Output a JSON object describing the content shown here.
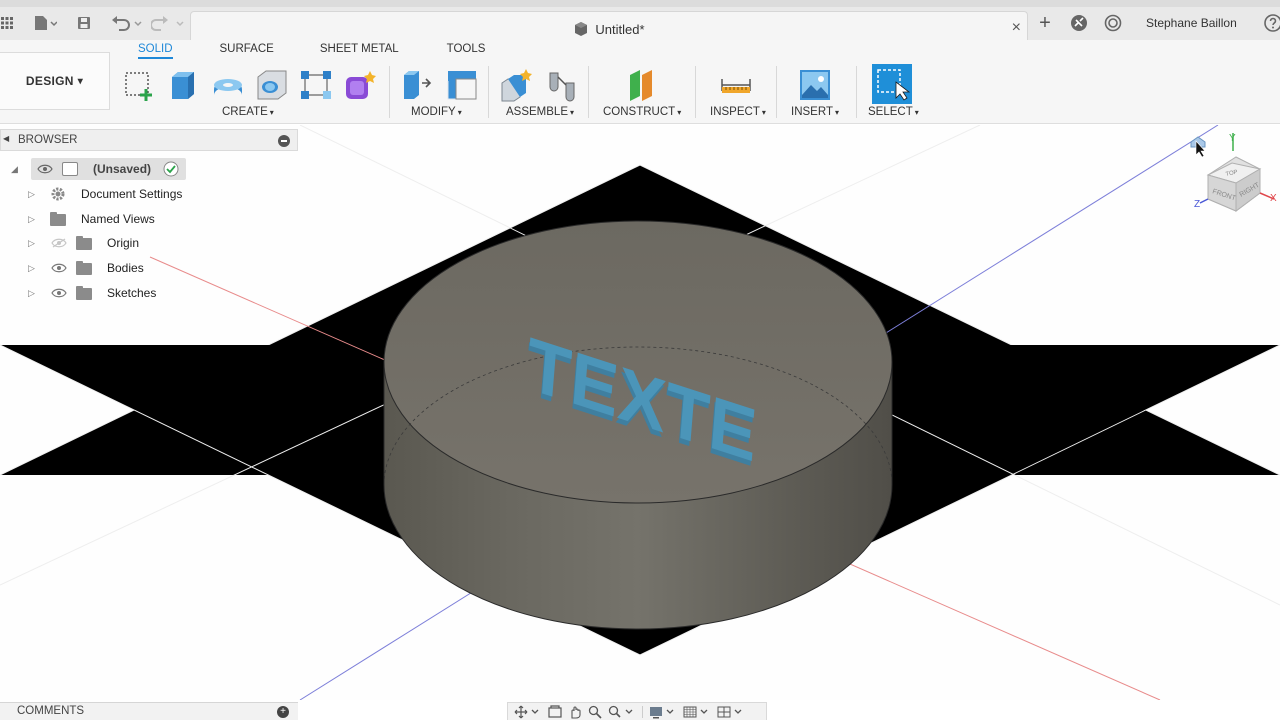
{
  "document": {
    "title": "Untitled*",
    "close_glyph": "×"
  },
  "header": {
    "user_name": "Stephane Baillon",
    "add_tab_glyph": "+"
  },
  "workspace": {
    "design_label": "DESIGN",
    "tabs": [
      {
        "label": "SOLID",
        "active": true
      },
      {
        "label": "SURFACE",
        "active": false
      },
      {
        "label": "SHEET METAL",
        "active": false
      },
      {
        "label": "TOOLS",
        "active": false
      }
    ],
    "groups": {
      "create": "CREATE",
      "modify": "MODIFY",
      "assemble": "ASSEMBLE",
      "construct": "CONSTRUCT",
      "inspect": "INSPECT",
      "insert": "INSERT",
      "select": "SELECT"
    },
    "caret": "▾"
  },
  "browser": {
    "title": "BROWSER",
    "root": "(Unsaved)",
    "items": [
      {
        "label": "Document Settings",
        "icon": "gear-icon"
      },
      {
        "label": "Named Views",
        "icon": "folder-icon"
      },
      {
        "label": "Origin",
        "icon": "folder-icon"
      },
      {
        "label": "Bodies",
        "icon": "folder-icon"
      },
      {
        "label": "Sketches",
        "icon": "folder-icon"
      }
    ]
  },
  "model": {
    "embossed_text": "TEXTE",
    "body_color": "#6f6c65",
    "text_color": "#4b95b9"
  },
  "viewcube": {
    "top": "TOP",
    "front": "FRONT",
    "right": "RIGHT",
    "x": "X",
    "y": "Y",
    "z": "Z"
  },
  "comments": {
    "title": "COMMENTS",
    "add_glyph": "+"
  },
  "colors": {
    "accent": "#1e88d8",
    "axis_x": "#e88b8b",
    "axis_y": "#7d7fd9",
    "select_blue": "#1f8fd8"
  }
}
